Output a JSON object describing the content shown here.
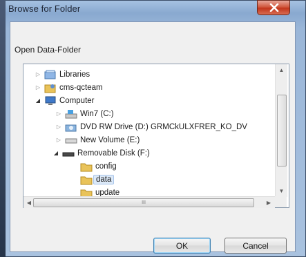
{
  "window": {
    "title": "Browse for Folder"
  },
  "dialog": {
    "prompt": "Open Data-Folder"
  },
  "tree": {
    "items": [
      {
        "label": "Libraries",
        "icon": "libraries-icon",
        "toggle": "▷"
      },
      {
        "label": "cms-qcteam",
        "icon": "user-folder-icon",
        "toggle": "▷"
      },
      {
        "label": "Computer",
        "icon": "computer-icon",
        "toggle": "◢"
      },
      {
        "label": "Win7 (C:)",
        "icon": "system-drive-icon",
        "toggle": "▷"
      },
      {
        "label": "DVD RW Drive (D:) GRMCkULXFRER_KO_DV",
        "icon": "dvd-drive-icon",
        "toggle": "▷"
      },
      {
        "label": "New Volume (E:)",
        "icon": "hard-drive-icon",
        "toggle": "▷"
      },
      {
        "label": "Removable Disk (F:)",
        "icon": "removable-disk-icon",
        "toggle": "◢"
      },
      {
        "label": "config",
        "icon": "folder-icon",
        "toggle": ""
      },
      {
        "label": "data",
        "icon": "folder-icon",
        "toggle": "",
        "selected": true
      },
      {
        "label": "update",
        "icon": "folder-icon",
        "toggle": ""
      }
    ]
  },
  "scrollbar": {
    "h_thumb_grip": "III"
  },
  "buttons": {
    "ok": "OK",
    "cancel": "Cancel"
  },
  "colors": {
    "close_button": "#c2361c",
    "selection": "#dce9f8",
    "folder": "#e9c35a"
  }
}
